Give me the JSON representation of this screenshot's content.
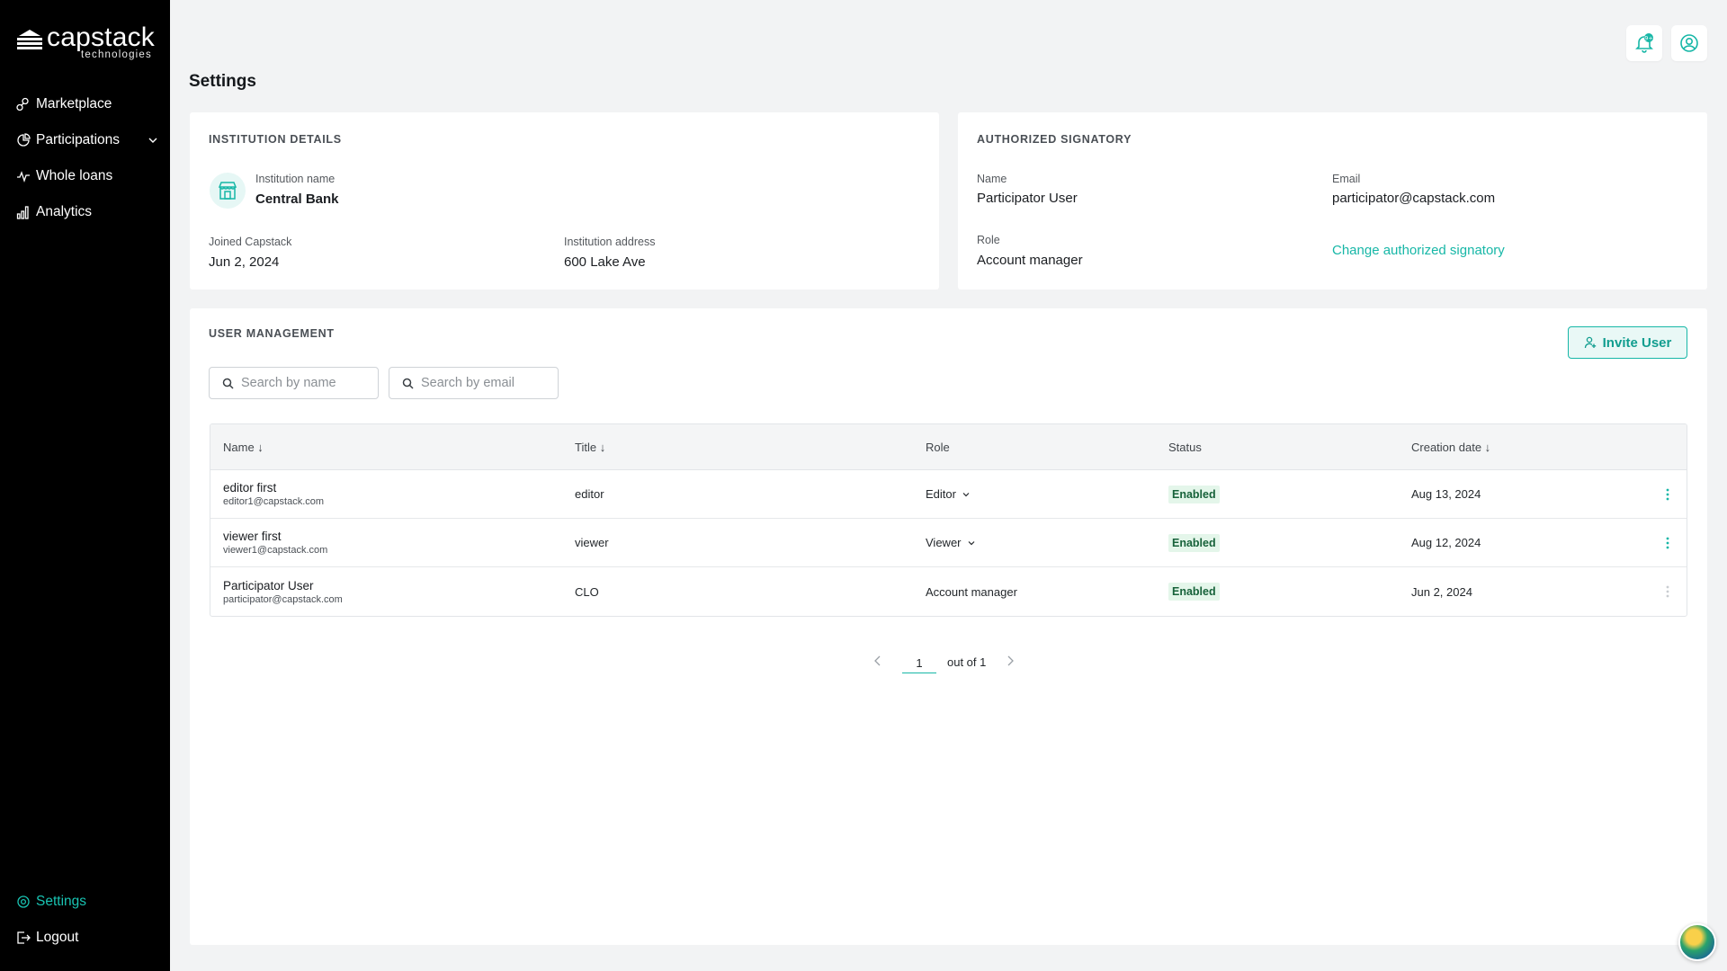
{
  "brand": {
    "name": "capstack",
    "sub": "technologies"
  },
  "sidebar": {
    "items": [
      {
        "label": "Marketplace",
        "icon": "marketplace-icon"
      },
      {
        "label": "Participations",
        "icon": "pie-chart-icon"
      },
      {
        "label": "Whole loans",
        "icon": "activity-icon"
      },
      {
        "label": "Analytics",
        "icon": "bar-chart-icon"
      }
    ],
    "bottom": [
      {
        "label": "Settings",
        "icon": "gear-icon"
      },
      {
        "label": "Logout",
        "icon": "logout-icon"
      }
    ]
  },
  "header": {
    "title": "Settings",
    "notification_badge": "9+"
  },
  "institution": {
    "section_title": "INSTITUTION DETAILS",
    "name_label": "Institution name",
    "name": "Central Bank",
    "joined_label": "Joined Capstack",
    "joined": "Jun 2, 2024",
    "address_label": "Institution address",
    "address": "600 Lake Ave"
  },
  "signatory": {
    "section_title": "AUTHORIZED SIGNATORY",
    "name_label": "Name",
    "name": "Participator User",
    "email_label": "Email",
    "email": "participator@capstack.com",
    "role_label": "Role",
    "role": "Account manager",
    "change_link": "Change authorized signatory"
  },
  "users": {
    "section_title": "USER MANAGEMENT",
    "invite_label": "Invite User",
    "search_name_placeholder": "Search by name",
    "search_email_placeholder": "Search by email",
    "columns": [
      "Name ↓",
      "Title ↓",
      "Role",
      "Status",
      "Creation date ↓"
    ],
    "rows": [
      {
        "name": "editor first",
        "email": "editor1@capstack.com",
        "title": "editor",
        "role": "Editor",
        "status": "Enabled",
        "date": "Aug 13, 2024"
      },
      {
        "name": "viewer first",
        "email": "viewer1@capstack.com",
        "title": "viewer",
        "role": "Viewer",
        "status": "Enabled",
        "date": "Aug 12, 2024"
      },
      {
        "name": "Participator User",
        "email": "participator@capstack.com",
        "title": "CLO",
        "role": "Account manager",
        "status": "Enabled",
        "date": "Jun 2, 2024"
      }
    ],
    "pagination": {
      "page": "1",
      "total_text": "out of 1"
    }
  },
  "colors": {
    "accent": "#17b7a7",
    "sidebar_bg": "#000000",
    "page_bg": "#f2f3f4",
    "badge_bg": "#e4f6ea"
  }
}
